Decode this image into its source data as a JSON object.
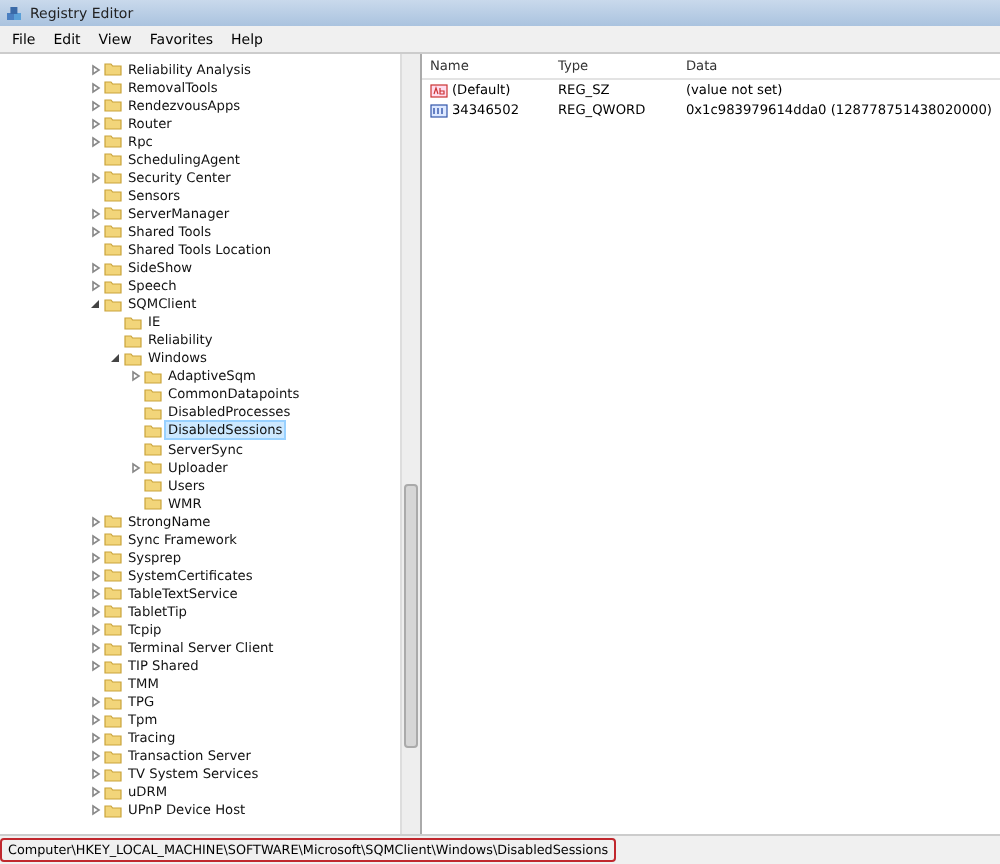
{
  "window": {
    "title": "Registry Editor"
  },
  "menu": [
    "File",
    "Edit",
    "View",
    "Favorites",
    "Help"
  ],
  "tree": [
    {
      "name": "Reliability Analysis",
      "expanded": false,
      "selected": false
    },
    {
      "name": "RemovalTools",
      "expanded": false,
      "selected": false
    },
    {
      "name": "RendezvousApps",
      "expanded": false,
      "selected": false
    },
    {
      "name": "Router",
      "expanded": false,
      "selected": false
    },
    {
      "name": "Rpc",
      "expanded": false,
      "selected": false
    },
    {
      "name": "SchedulingAgent",
      "selected": false
    },
    {
      "name": "Security Center",
      "expanded": false,
      "selected": false
    },
    {
      "name": "Sensors",
      "selected": false
    },
    {
      "name": "ServerManager",
      "expanded": false,
      "selected": false
    },
    {
      "name": "Shared Tools",
      "expanded": false,
      "selected": false
    },
    {
      "name": "Shared Tools Location",
      "selected": false
    },
    {
      "name": "SideShow",
      "expanded": false,
      "selected": false
    },
    {
      "name": "Speech",
      "expanded": false,
      "selected": false
    },
    {
      "name": "SQMClient",
      "expanded": true,
      "selected": false,
      "children": [
        {
          "name": "IE",
          "selected": false
        },
        {
          "name": "Reliability",
          "selected": false
        },
        {
          "name": "Windows",
          "expanded": true,
          "selected": false,
          "children": [
            {
              "name": "AdaptiveSqm",
              "expanded": false,
              "selected": false
            },
            {
              "name": "CommonDatapoints",
              "selected": false
            },
            {
              "name": "DisabledProcesses",
              "selected": false
            },
            {
              "name": "DisabledSessions",
              "selected": true
            },
            {
              "name": "ServerSync",
              "selected": false
            },
            {
              "name": "Uploader",
              "expanded": false,
              "selected": false
            },
            {
              "name": "Users",
              "selected": false
            },
            {
              "name": "WMR",
              "selected": false
            }
          ]
        }
      ]
    },
    {
      "name": "StrongName",
      "expanded": false,
      "selected": false
    },
    {
      "name": "Sync Framework",
      "expanded": false,
      "selected": false
    },
    {
      "name": "Sysprep",
      "expanded": false,
      "selected": false
    },
    {
      "name": "SystemCertificates",
      "expanded": false,
      "selected": false
    },
    {
      "name": "TableTextService",
      "expanded": false,
      "selected": false
    },
    {
      "name": "TabletTip",
      "expanded": false,
      "selected": false
    },
    {
      "name": "Tcpip",
      "expanded": false,
      "selected": false
    },
    {
      "name": "Terminal Server Client",
      "expanded": false,
      "selected": false
    },
    {
      "name": "TIP Shared",
      "expanded": false,
      "selected": false
    },
    {
      "name": "TMM",
      "selected": false
    },
    {
      "name": "TPG",
      "expanded": false,
      "selected": false
    },
    {
      "name": "Tpm",
      "expanded": false,
      "selected": false
    },
    {
      "name": "Tracing",
      "expanded": false,
      "selected": false
    },
    {
      "name": "Transaction Server",
      "expanded": false,
      "selected": false
    },
    {
      "name": "TV System Services",
      "expanded": false,
      "selected": false
    },
    {
      "name": "uDRM",
      "expanded": false,
      "selected": false
    },
    {
      "name": "UPnP Device Host",
      "expanded": false,
      "selected": false
    }
  ],
  "values": {
    "columns": [
      "Name",
      "Type",
      "Data"
    ],
    "rows": [
      {
        "kind": "string",
        "name": "(Default)",
        "type": "REG_SZ",
        "data": "(value not set)"
      },
      {
        "kind": "binary",
        "name": "34346502",
        "type": "REG_QWORD",
        "data": "0x1c983979614dda0 (128778751438020000)"
      }
    ]
  },
  "status_bar": {
    "path": "Computer\\HKEY_LOCAL_MACHINE\\SOFTWARE\\Microsoft\\SQMClient\\Windows\\DisabledSessions",
    "highlighted": true
  }
}
